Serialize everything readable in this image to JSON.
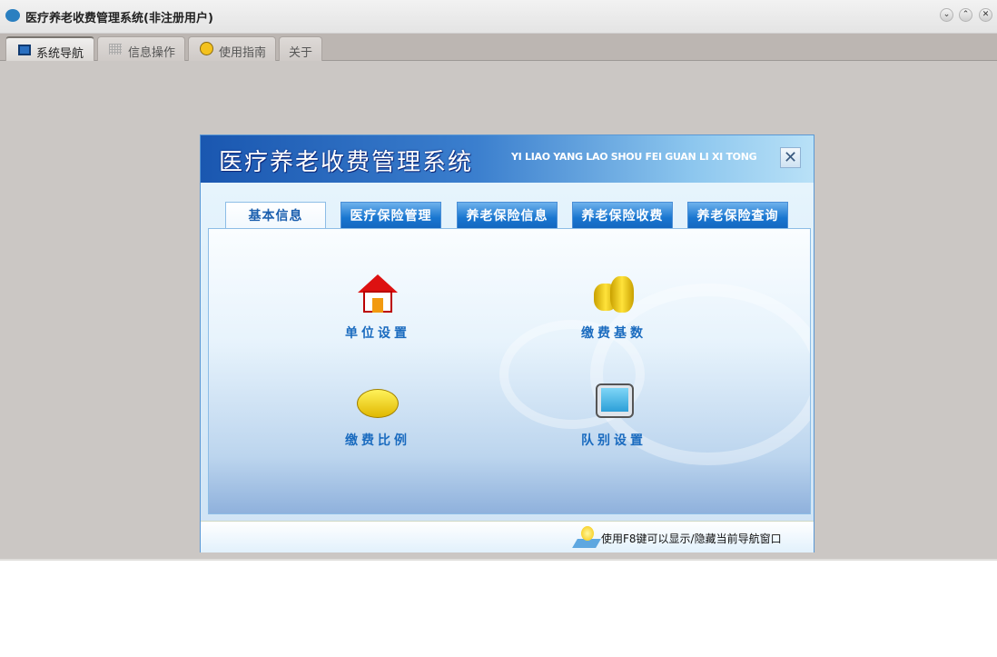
{
  "window": {
    "title": "医疗养老收费管理系统(非注册用户)",
    "controls": [
      "minimize",
      "maximize",
      "close"
    ]
  },
  "tabs": [
    {
      "label": "系统导航",
      "icon": "monitor-icon",
      "active": true
    },
    {
      "label": "信息操作",
      "icon": "grid-icon"
    },
    {
      "label": "使用指南",
      "icon": "help-icon"
    },
    {
      "label": "关于"
    }
  ],
  "dialog": {
    "title": "医疗养老收费管理系统",
    "subtitle": "YI LIAO YANG LAO SHOU FEI GUAN LI XI TONG",
    "close": "✕",
    "tabs": [
      "基本信息",
      "医疗保险管理",
      "养老保险信息",
      "养老保险收费",
      "养老保险查询"
    ],
    "items": [
      {
        "label": "单位设置",
        "icon": "house-icon"
      },
      {
        "label": "缴费基数",
        "icon": "coins-icon"
      },
      {
        "label": "缴费比例",
        "icon": "coin-icon"
      },
      {
        "label": "队别设置",
        "icon": "monitor-icon"
      }
    ],
    "tip": "使用F8键可以显示/隐藏当前导航窗口"
  }
}
